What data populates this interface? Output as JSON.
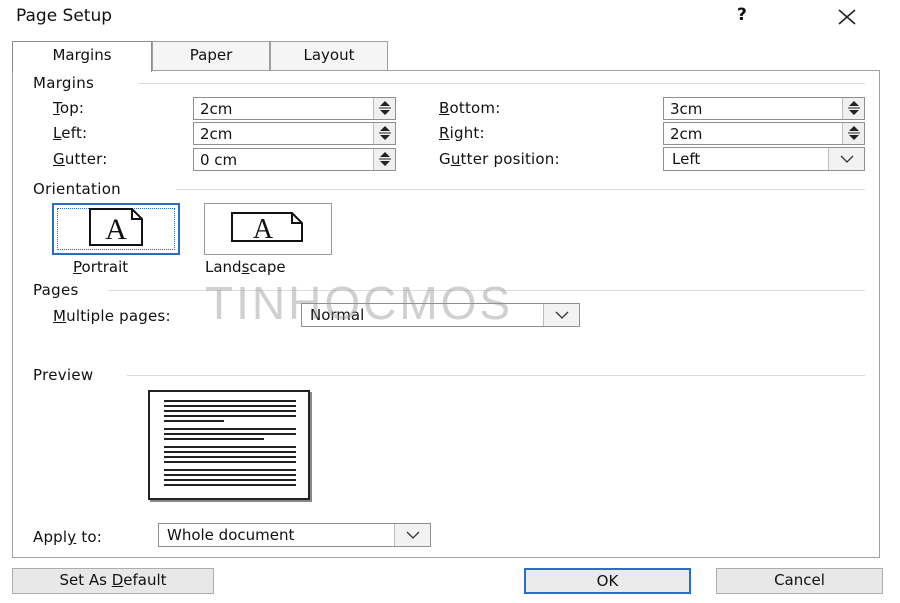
{
  "window": {
    "title": "Page Setup",
    "help": "?"
  },
  "tabs": [
    {
      "label": "Margins"
    },
    {
      "label": "Paper"
    },
    {
      "label": "Layout"
    }
  ],
  "margins_group": {
    "label": "Margins",
    "top": {
      "label_pre": "",
      "label_ul": "T",
      "label_post": "op:",
      "value": "2cm"
    },
    "left": {
      "label_pre": "",
      "label_ul": "L",
      "label_post": "eft:",
      "value": "2cm"
    },
    "gutter": {
      "label_pre": "",
      "label_ul": "G",
      "label_post": "utter:",
      "value": "0 cm"
    },
    "bottom": {
      "label_pre": "",
      "label_ul": "B",
      "label_post": "ottom:",
      "value": "3cm"
    },
    "right": {
      "label_pre": "",
      "label_ul": "R",
      "label_post": "ight:",
      "value": "2cm"
    },
    "gutter_position": {
      "label_pre": "G",
      "label_ul": "u",
      "label_post": "tter position:",
      "value": "Left"
    }
  },
  "orientation_group": {
    "label": "Orientation",
    "portrait": {
      "label_pre": "",
      "label_ul": "P",
      "label_post": "ortrait",
      "glyph": "A",
      "selected": true
    },
    "landscape": {
      "label_pre": "Land",
      "label_ul": "s",
      "label_post": "cape",
      "glyph": "A",
      "selected": false
    }
  },
  "pages_group": {
    "label": "Pages",
    "multiple_pages": {
      "label_pre": "",
      "label_ul": "M",
      "label_post": "ultiple pages:",
      "value": "Normal"
    }
  },
  "watermark": "TINHOCMOS",
  "preview_group": {
    "label": "Preview"
  },
  "apply_to": {
    "label_pre": "Appl",
    "label_ul": "y",
    "label_post": " to:",
    "value": "Whole document"
  },
  "buttons": {
    "set_default": {
      "label_pre": "Set As ",
      "label_ul": "D",
      "label_post": "efault"
    },
    "ok": "OK",
    "cancel": "Cancel"
  },
  "colors": {
    "accent": "#2b6cc4",
    "border": "#a0a0a0"
  },
  "icons": [
    "help-icon",
    "close-icon",
    "spin-arrows-icon",
    "chevron-down-icon",
    "portrait-page-icon",
    "landscape-page-icon"
  ]
}
